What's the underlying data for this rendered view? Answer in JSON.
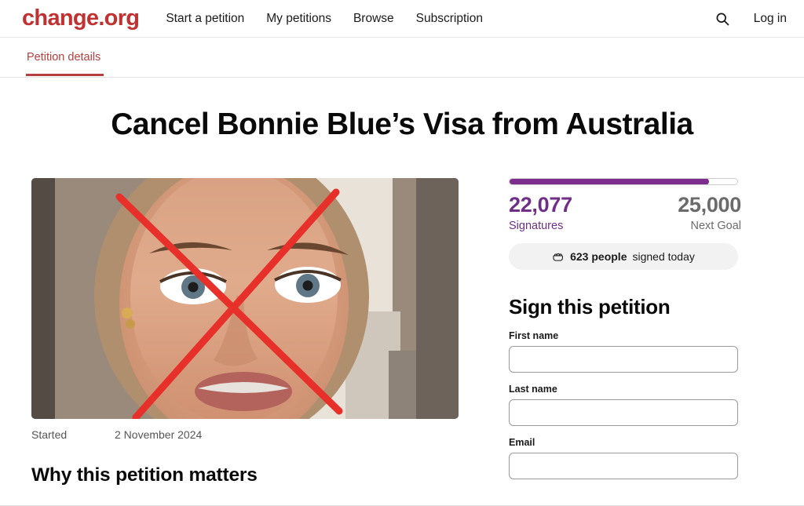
{
  "header": {
    "logo": "change.org",
    "nav": [
      {
        "label": "Start a petition",
        "name": "nav-start-a-petition"
      },
      {
        "label": "My petitions",
        "name": "nav-my-petitions"
      },
      {
        "label": "Browse",
        "name": "nav-browse"
      },
      {
        "label": "Subscription",
        "name": "nav-subscription"
      }
    ],
    "search_icon": "search-icon",
    "login_label": "Log in"
  },
  "tabs": [
    {
      "label": "Petition details",
      "active": true
    }
  ],
  "main": {
    "title": "Cancel Bonnie Blue’s Visa from Australia",
    "hero_alt": "petition-hero-image",
    "meta": {
      "started_label": "Started",
      "started_value": "2 November 2024"
    },
    "why_heading": "Why this petition matters"
  },
  "sidebar": {
    "progress": {
      "percent": 88,
      "fill_color": "#7d2d8e",
      "track_color": "#ffffff"
    },
    "signatures": {
      "count": "22,077",
      "label": "Signatures",
      "color": "#6f2f86"
    },
    "goal": {
      "count": "25,000",
      "label": "Next Goal",
      "color": "#6b6b6b"
    },
    "signed_today": {
      "icon": "raised-fist-icon",
      "count": "623 people",
      "suffix": "signed today"
    },
    "form": {
      "heading": "Sign this petition",
      "fields": [
        {
          "label": "First name",
          "value": "",
          "placeholder": "",
          "name": "first-name-input"
        },
        {
          "label": "Last name",
          "value": "",
          "placeholder": "",
          "name": "last-name-input"
        },
        {
          "label": "Email",
          "value": "",
          "placeholder": "",
          "name": "email-input"
        }
      ]
    }
  },
  "colors": {
    "brand_red": "#c03131",
    "tab_red": "#b5403f",
    "purple": "#7d2d8e",
    "x_mark_red": "#e8302a"
  }
}
